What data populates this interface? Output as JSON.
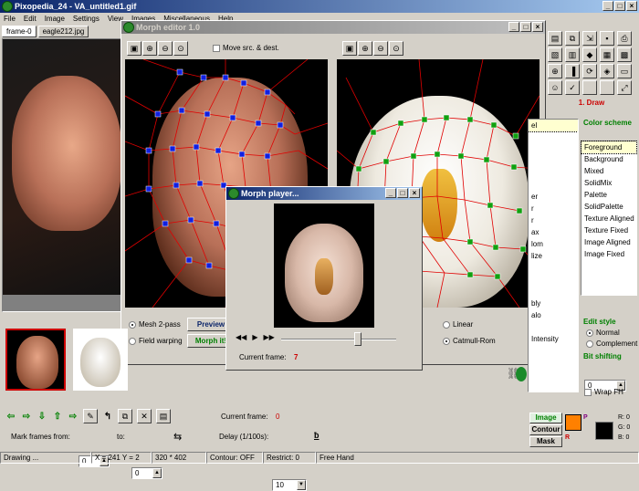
{
  "app": {
    "title": "Pixopedia_24  - VA_untitled1.gif"
  },
  "menu": [
    "File",
    "Edit",
    "Image",
    "Settings",
    "View",
    "Images",
    "Miscellaneous",
    "Help"
  ],
  "tabs": [
    "frame-0",
    "eagle212.jpg"
  ],
  "morph_editor": {
    "title": "Morph editor 1.0",
    "move_label": "Move src. & dest.",
    "mesh_2pass": "Mesh 2-pass",
    "field_warping": "Field warping",
    "preview": "Preview",
    "morph_it": "Morph it!",
    "linear": "Linear",
    "catmull": "Catmull-Rom"
  },
  "morph_player": {
    "title": "Morph player...",
    "current_frame_label": "Current frame:",
    "current_frame_value": "7"
  },
  "right_panel": {
    "draw_label": "1.  Draw",
    "color_scheme_title": "Color scheme",
    "color_scheme_items": [
      "Foreground",
      "Background",
      "Mixed",
      "SolidMix",
      "Palette",
      "SolidPalette",
      "Texture Aligned",
      "Texture Fixed",
      "Image Aligned",
      "Image Fixed"
    ],
    "left_list_items": [
      "el",
      "",
      "",
      "",
      "",
      "",
      "er",
      "r",
      "r",
      "ax",
      "lom",
      "lize",
      "",
      "",
      "",
      "bly",
      "alo",
      "",
      "Intensity"
    ],
    "edit_style_title": "Edit style",
    "edit_normal": "Normal",
    "edit_complement": "Complement",
    "bit_shifting_title": "Bit shifting",
    "bit_value": "0",
    "wrap_fh": "Wrap FH",
    "image_btn": "Image",
    "contour_btn": "Contour",
    "mask_btn": "Mask",
    "p_label": "P",
    "r_label": "R",
    "rgb_r": "R: 0",
    "rgb_g": "G: 0",
    "rgb_b": "B: 0"
  },
  "bottom": {
    "current_frame_label": "Current frame:",
    "current_frame_value": "0",
    "mark_frames_from": "Mark frames from:",
    "from_value": "0",
    "to_label": "to:",
    "to_value": "0",
    "delay_label": "Delay (1/100s):",
    "delay_value": "10"
  },
  "status": [
    "Drawing ...",
    "X = 241 Y = 2",
    "320 * 402",
    "Contour: OFF",
    "Restrict: 0",
    "Free Hand"
  ],
  "colors": {
    "accent_red": "#cc0000",
    "fg_color": "#ff8000",
    "title_blue": "#0a246a"
  }
}
